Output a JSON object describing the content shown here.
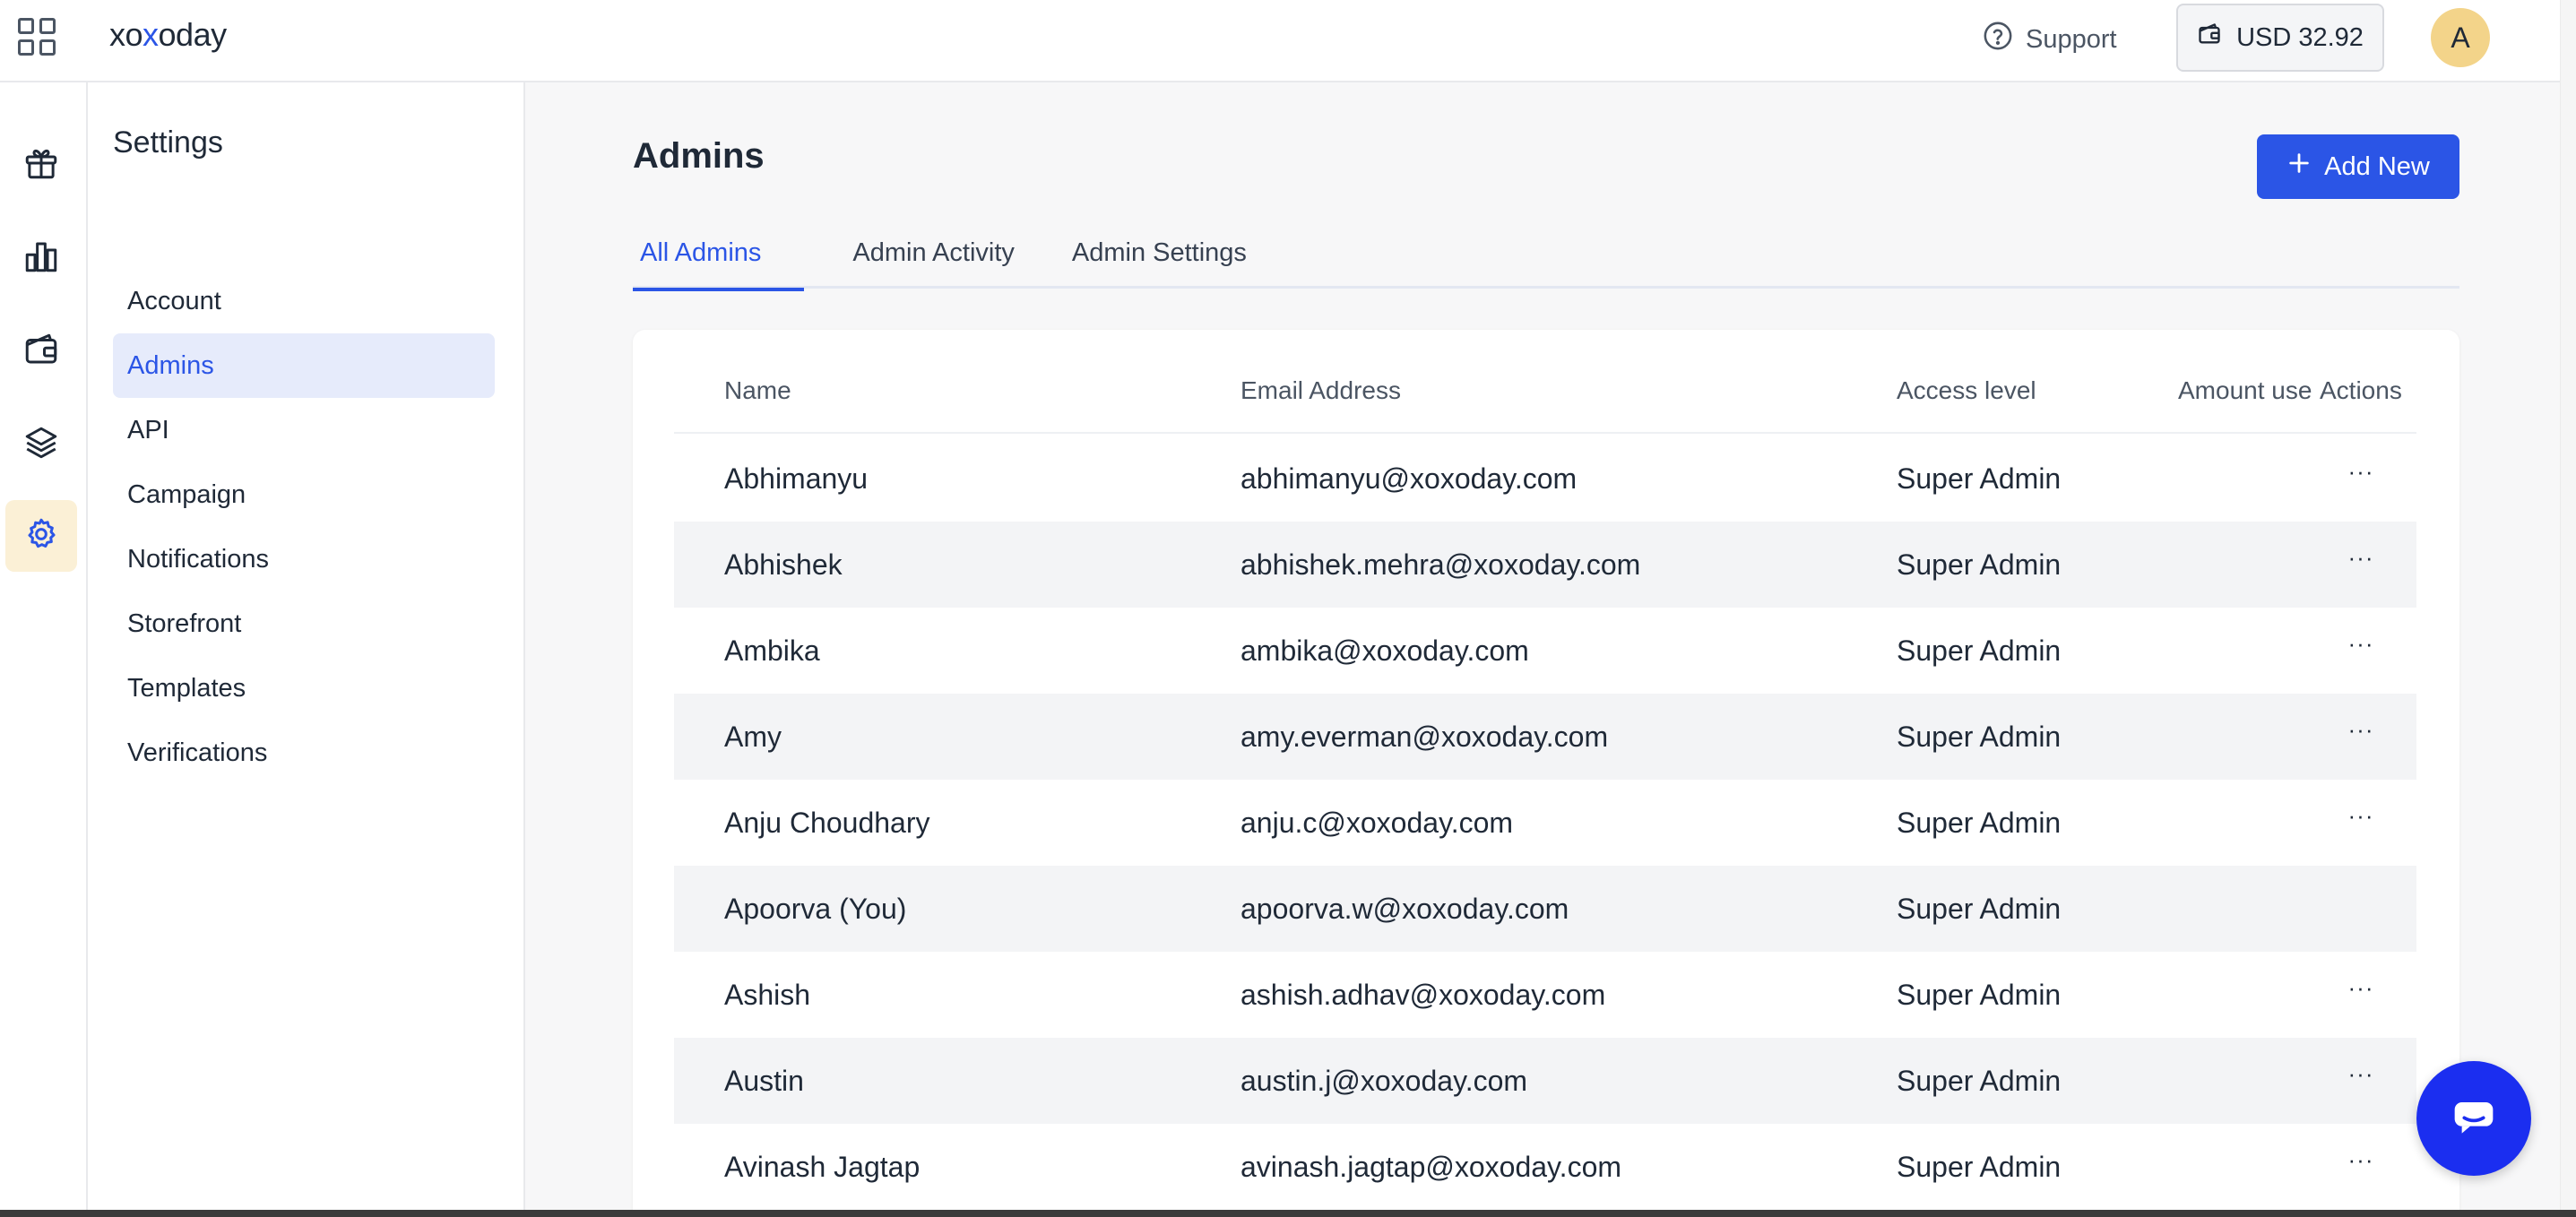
{
  "brand": {
    "logo_pre": "xo",
    "logo_x": "x",
    "logo_post": "oday"
  },
  "header": {
    "support_label": "Support",
    "wallet_label": "USD 32.92",
    "avatar_initial": "A"
  },
  "rail": {
    "items": [
      {
        "icon": "gift-icon"
      },
      {
        "icon": "bar-chart-icon"
      },
      {
        "icon": "wallet-icon"
      },
      {
        "icon": "layers-icon"
      },
      {
        "icon": "gear-icon",
        "active": true
      }
    ]
  },
  "settings": {
    "title": "Settings",
    "items": [
      {
        "label": "Account"
      },
      {
        "label": "Admins",
        "active": true
      },
      {
        "label": "API"
      },
      {
        "label": "Campaign"
      },
      {
        "label": "Notifications"
      },
      {
        "label": "Storefront"
      },
      {
        "label": "Templates"
      },
      {
        "label": "Verifications"
      }
    ]
  },
  "main": {
    "title": "Admins",
    "add_button_label": "Add New",
    "tabs": [
      {
        "label": "All Admins",
        "active": true
      },
      {
        "label": "Admin Activity"
      },
      {
        "label": "Admin Settings"
      }
    ],
    "table": {
      "columns": {
        "name": "Name",
        "email": "Email Address",
        "access": "Access level",
        "amount": "Amount use",
        "actions": "Actions"
      },
      "rows": [
        {
          "name": "Abhimanyu",
          "email": "abhimanyu@xoxoday.com",
          "access": "Super Admin",
          "actions": "···"
        },
        {
          "name": "Abhishek",
          "email": "abhishek.mehra@xoxoday.com",
          "access": "Super Admin",
          "actions": "···"
        },
        {
          "name": "Ambika",
          "email": "ambika@xoxoday.com",
          "access": "Super Admin",
          "actions": "···"
        },
        {
          "name": "Amy",
          "email": "amy.everman@xoxoday.com",
          "access": "Super Admin",
          "actions": "···"
        },
        {
          "name": "Anju Choudhary",
          "email": "anju.c@xoxoday.com",
          "access": "Super Admin",
          "actions": "···"
        },
        {
          "name": "Apoorva (You)",
          "email": "apoorva.w@xoxoday.com",
          "access": "Super Admin",
          "actions": ""
        },
        {
          "name": "Ashish",
          "email": "ashish.adhav@xoxoday.com",
          "access": "Super Admin",
          "actions": "···"
        },
        {
          "name": "Austin",
          "email": "austin.j@xoxoday.com",
          "access": "Super Admin",
          "actions": "···"
        },
        {
          "name": "Avinash Jagtap",
          "email": "avinash.jagtap@xoxoday.com",
          "access": "Super Admin",
          "actions": "···"
        }
      ]
    }
  },
  "colors": {
    "accent": "#2b55e6",
    "active_nav_bg": "#e6ebfb",
    "active_rail_bg": "#fbf0d6",
    "chat_button": "#1b2ef0",
    "avatar_bg": "#f3d48a"
  }
}
